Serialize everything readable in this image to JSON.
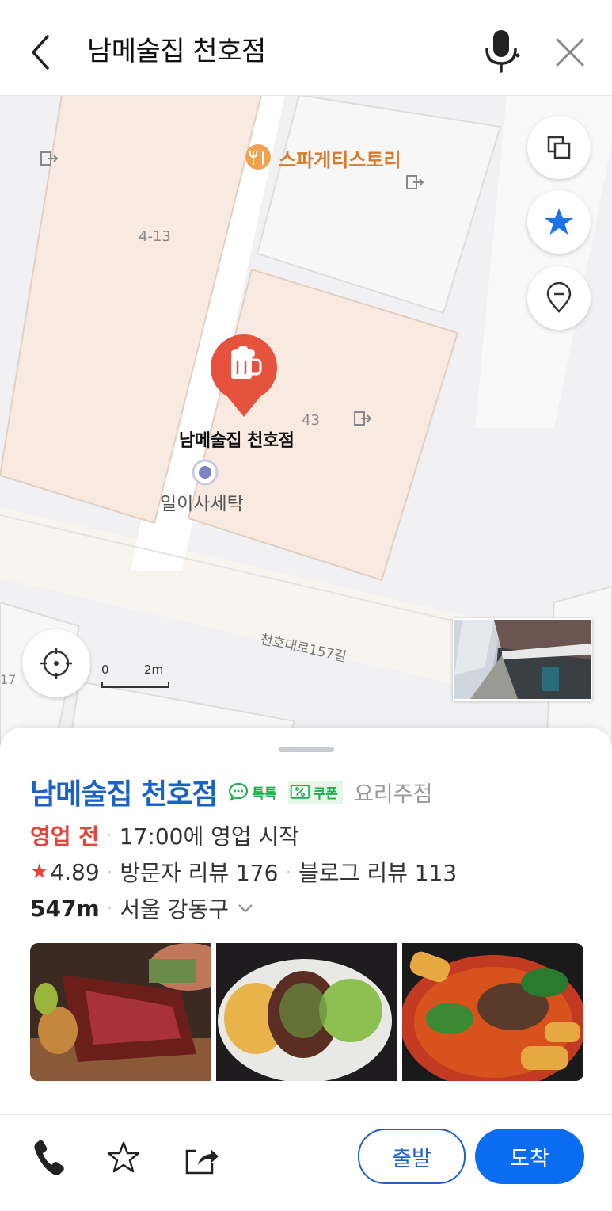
{
  "header": {
    "search_text": "남메술집 천호점",
    "icons": {
      "back": "chevron-left-icon",
      "mic": "microphone-icon",
      "close": "close-icon"
    }
  },
  "map": {
    "poi_pasta": "스파게티스토리",
    "building_413": "4-13",
    "building_43": "43",
    "selected_place": "남메술집 천호점",
    "laundry": "일이사세탁",
    "road": "천호대로157길",
    "edge_number": "17",
    "scale_zero": "0",
    "scale_max": "2m",
    "icons": {
      "layers": "layers-icon",
      "favorite": "star-icon",
      "pin": "location-pin-icon",
      "locate": "crosshair-icon",
      "marker": "beer-mug-icon"
    },
    "colors": {
      "building": "#f8eae0",
      "road": "#ffffff",
      "marker": "#e5533f",
      "accent": "#1a73e8"
    }
  },
  "place": {
    "name": "남메술집 천호점",
    "talk_badge": "톡톡",
    "coupon_badge": "쿠폰",
    "category": "요리주점",
    "status": "영업 전",
    "hours": "17:00에 영업 시작",
    "rating": "4.89",
    "visitor_reviews": "방문자 리뷰 176",
    "blog_reviews": "블로그 리뷰 113",
    "distance": "547m",
    "address": "서울 강동구",
    "photos": [
      "steak-photo",
      "steak-fries-photo",
      "spicy-stew-photo"
    ]
  },
  "actions": {
    "depart": "출발",
    "arrive": "도착",
    "icons": {
      "call": "phone-icon",
      "favorite": "star-outline-icon",
      "share": "share-icon"
    }
  },
  "colors": {
    "brand_blue": "#1a63c4",
    "button_blue": "#0a6cf0",
    "status_red": "#e8433c",
    "badge_green": "#1fae4c"
  }
}
